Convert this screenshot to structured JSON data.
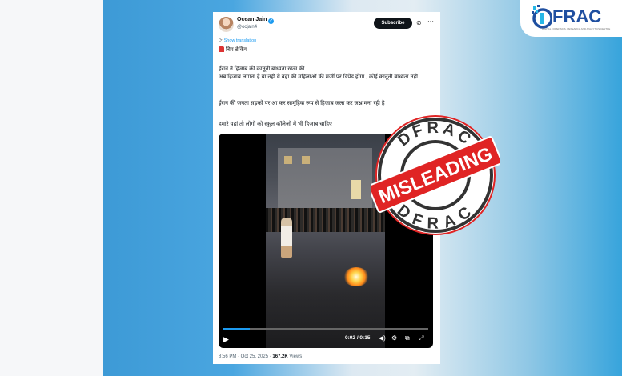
{
  "logo": {
    "text": "FRAC",
    "subtitle": "DIGITAL FORENSICS, RESEARCH AND ANALYTICS CENTRE",
    "brand_color": "#1f4fa0"
  },
  "tweet": {
    "author_name": "Ocean Jain",
    "handle": "@ocjain4",
    "subscribe_label": "Subscribe",
    "show_translation": "Show translation",
    "breaking": "बिग ब्रेकिंग",
    "line1": "ईरान ने हिजाब की कानूनी बाध्यता खत्म की",
    "line2": "अब हिजाब लगाना है या नही ये वहां की महिलाओं की मर्जी पर डिपेंड होगा , कोई कानूनी बाध्यता नही",
    "line3": "ईरान की जनता सड़कों पर आ कर सामूहिक रूप से हिजाब जला कर जश्न मना रही है",
    "line4": "हमारे यहां तो लोगों को स्कूल कॉलेजों में भी हिजाब चाहिए",
    "video_time": "0:02 / 0:15",
    "video_progress": 0.13,
    "timestamp": "8:56 PM · Oct 25, 2025 · ",
    "views_count": "167.2K",
    "views_label": " Views"
  },
  "stamp": {
    "top_text": "DFRAC",
    "bottom_text": "DFRAC",
    "label": "MISLEADING",
    "color": "#e02424"
  },
  "icons": [
    "verified-badge-icon",
    "grok-icon",
    "more-icon",
    "translate-icon",
    "siren-icon",
    "play-icon",
    "volume-icon",
    "settings-icon",
    "fullscreen-icon",
    "expand-icon"
  ]
}
